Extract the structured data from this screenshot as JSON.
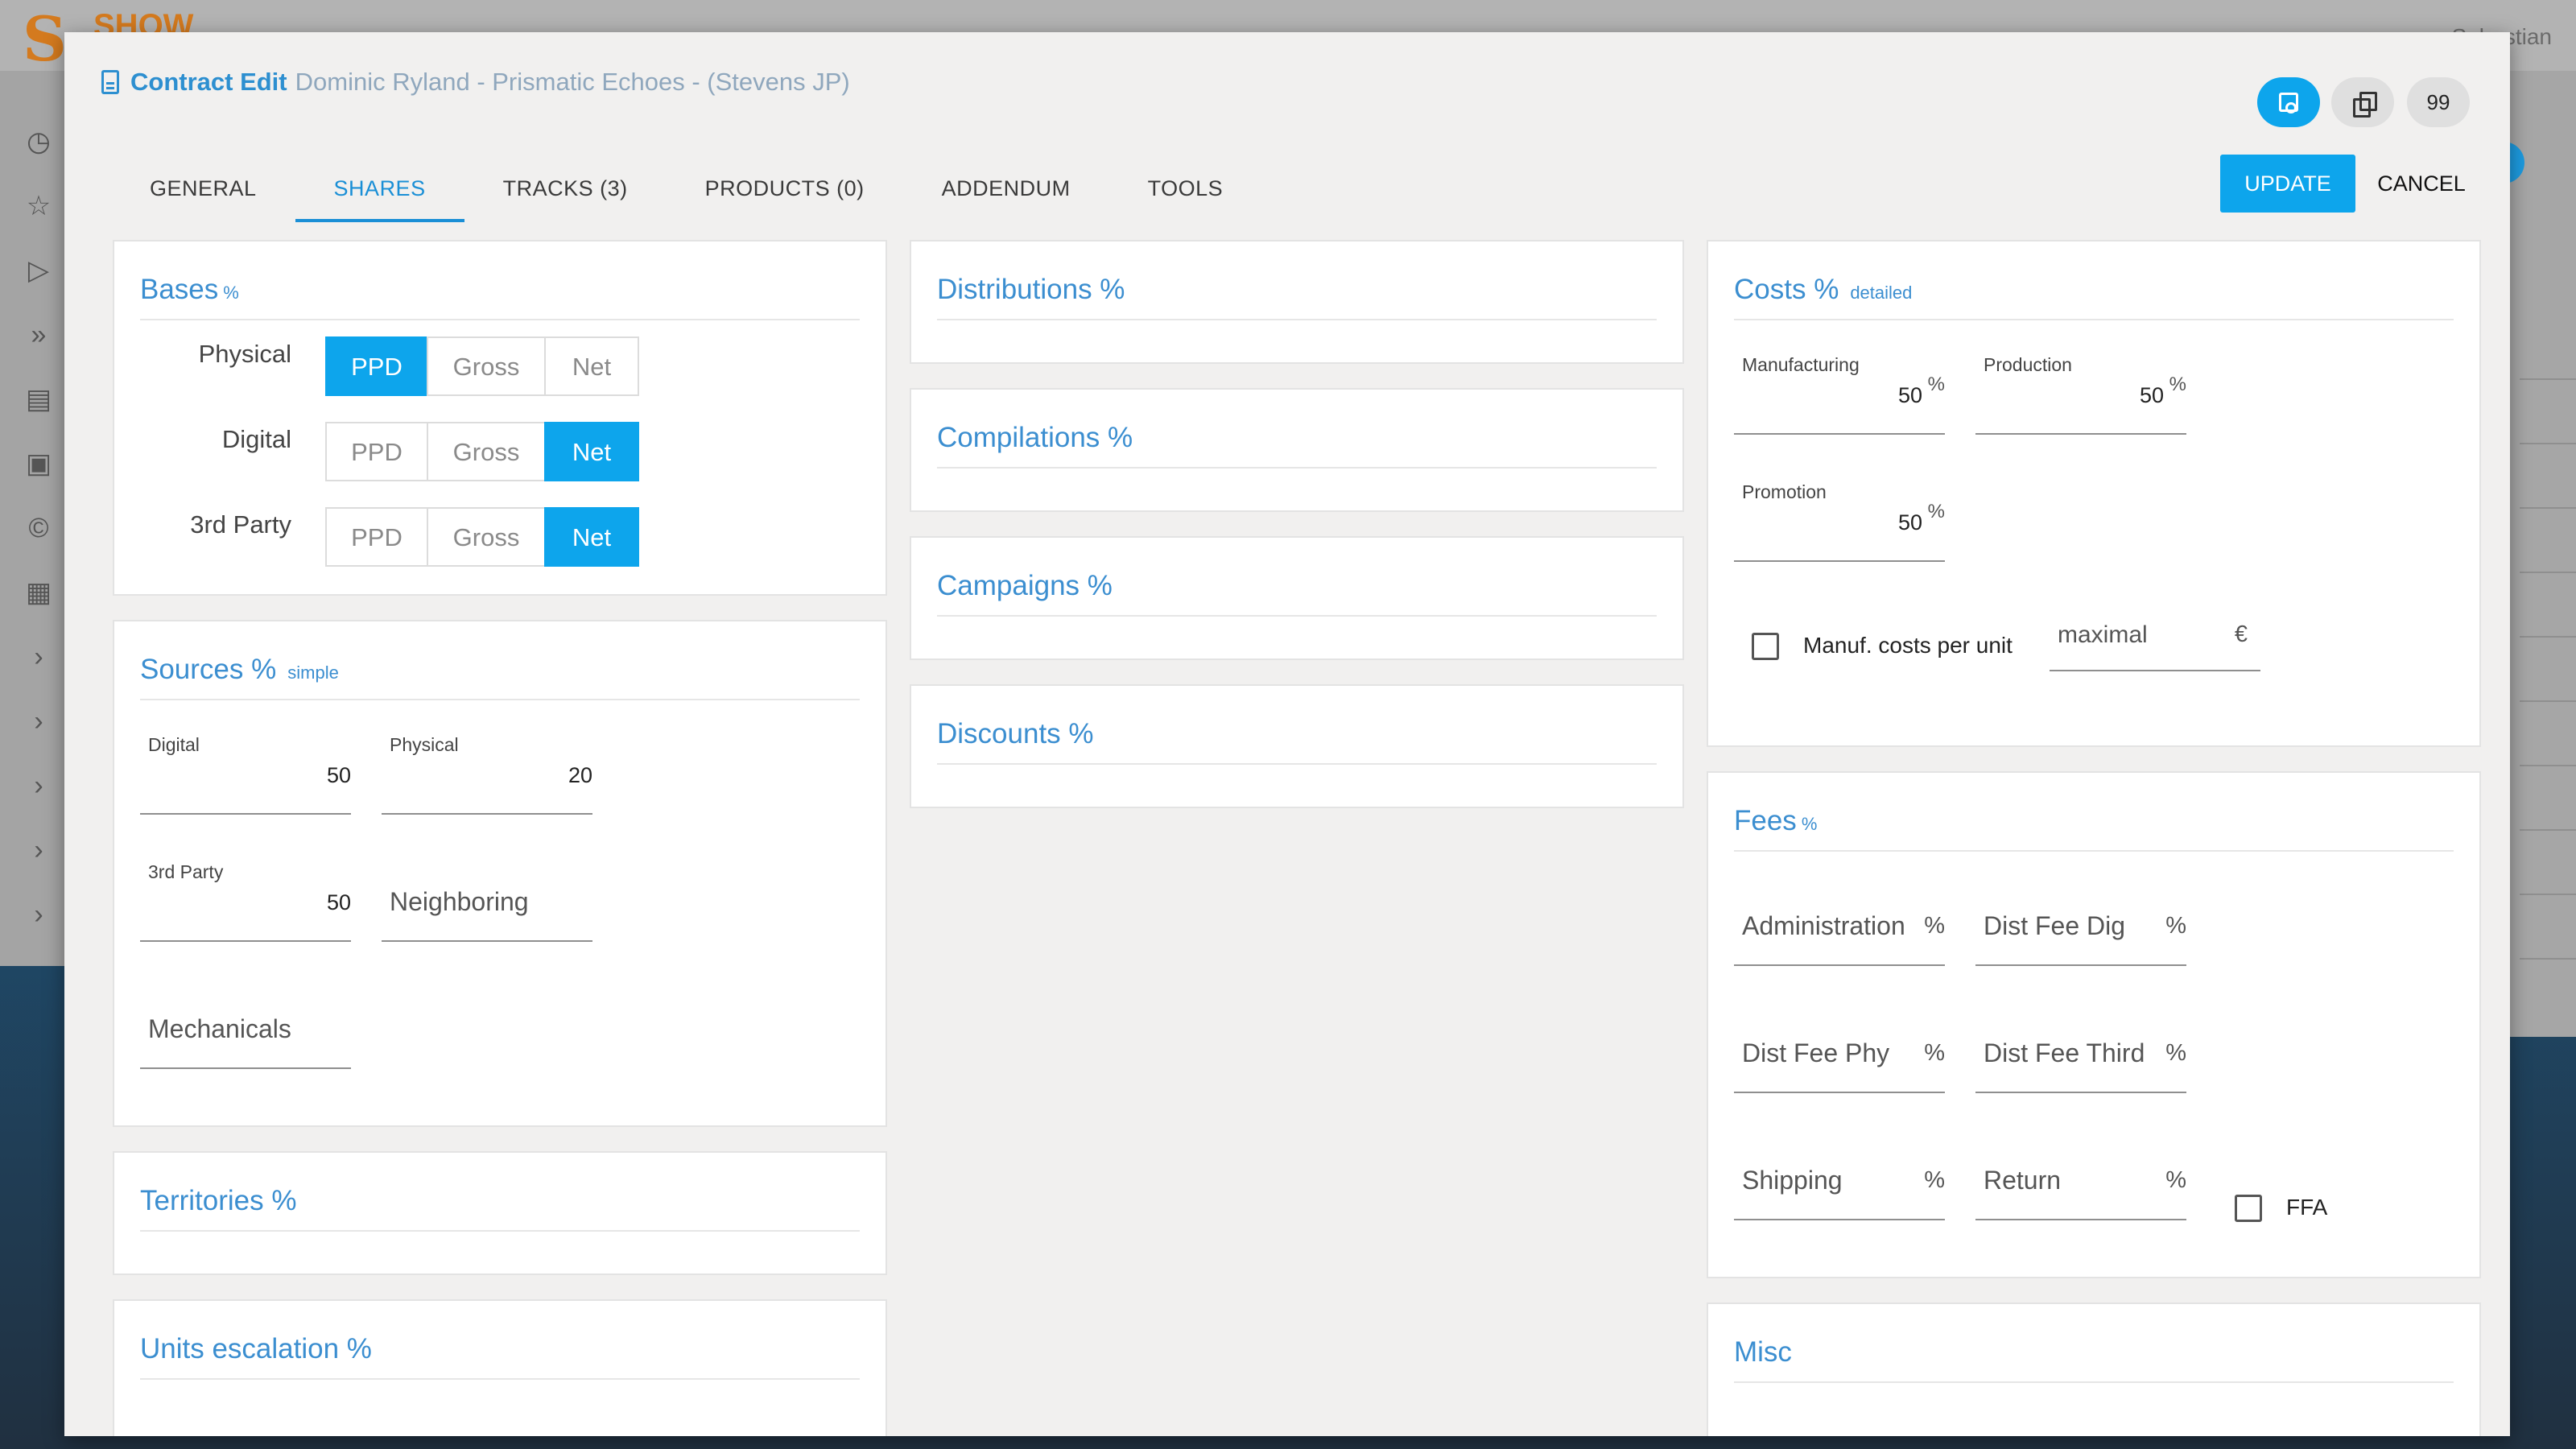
{
  "background": {
    "logo_text": "SHOW",
    "user_text": "Sebastian"
  },
  "modal": {
    "title": "Contract Edit",
    "subtitle": "Dominic Ryland - Prismatic Echoes - (Stevens JP)",
    "count_badge": "99",
    "tabs": [
      "GENERAL",
      "SHARES",
      "TRACKS (3)",
      "PRODUCTS (0)",
      "ADDENDUM",
      "TOOLS"
    ],
    "active_tab": "SHARES",
    "update_label": "UPDATE",
    "cancel_label": "CANCEL"
  },
  "bases": {
    "title": "Bases",
    "pct_mark": "%",
    "options": [
      "PPD",
      "Gross",
      "Net"
    ],
    "rows": [
      {
        "label": "Physical",
        "selected": "PPD"
      },
      {
        "label": "Digital",
        "selected": "Net"
      },
      {
        "label": "3rd Party",
        "selected": "Net"
      }
    ]
  },
  "sources": {
    "title": "Sources %",
    "mode": "simple",
    "digital": {
      "label": "Digital",
      "value": "50"
    },
    "physical": {
      "label": "Physical",
      "value": "20"
    },
    "third_party": {
      "label": "3rd Party",
      "value": "50"
    },
    "neighboring": {
      "placeholder": "Neighboring"
    },
    "mechanicals": {
      "placeholder": "Mechanicals"
    }
  },
  "territories": {
    "title": "Territories %"
  },
  "units_escalation": {
    "title": "Units escalation %"
  },
  "distributions": {
    "title": "Distributions %"
  },
  "compilations": {
    "title": "Compilations %"
  },
  "campaigns": {
    "title": "Campaigns %"
  },
  "discounts": {
    "title": "Discounts %"
  },
  "costs": {
    "title": "Costs %",
    "mode": "detailed",
    "manufacturing": {
      "label": "Manufacturing",
      "value": "50",
      "unit": "%"
    },
    "production": {
      "label": "Production",
      "value": "50",
      "unit": "%"
    },
    "promotion": {
      "label": "Promotion",
      "value": "50",
      "unit": "%"
    },
    "manuf_per_unit_label": "Manuf. costs per unit",
    "maximal": {
      "placeholder": "maximal",
      "unit": "€"
    }
  },
  "fees": {
    "title": "Fees",
    "pct_mark": "%",
    "fields": [
      {
        "label": "Administration",
        "unit": "%"
      },
      {
        "label": "Dist Fee Dig",
        "unit": "%"
      },
      {
        "label": "Dist Fee Phy",
        "unit": "%"
      },
      {
        "label": "Dist Fee Third",
        "unit": "%"
      },
      {
        "label": "Shipping",
        "unit": "%"
      },
      {
        "label": "Return",
        "unit": "%"
      }
    ],
    "ffa_label": "FFA"
  },
  "misc": {
    "title": "Misc"
  },
  "sidebar_icons": [
    "dashboard-icon",
    "star-icon",
    "play-icon",
    "fast-forward-icon",
    "contract-icon",
    "contacts-icon",
    "copyright-icon",
    "document-icon",
    "chevron-right-icon",
    "chevron-right-icon",
    "chevron-right-icon",
    "chevron-right-icon",
    "chevron-right-icon"
  ]
}
